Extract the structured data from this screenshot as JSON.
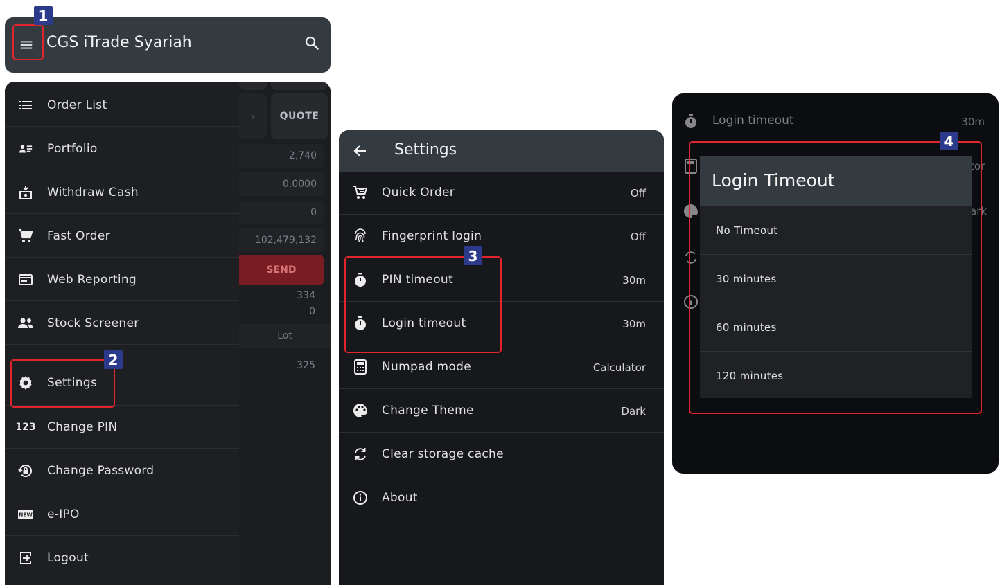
{
  "app_bar": {
    "title": "CGS iTrade Syariah",
    "menu_icon": "hamburger-menu-icon",
    "search_icon": "search-icon"
  },
  "order_background": {
    "quote_label": "QUOTE",
    "fields": [
      "2,740",
      "0.0000",
      "0",
      "102,479,132"
    ],
    "send_label": "SEND",
    "numbers": [
      "334",
      "0"
    ],
    "lot_label": "Lot",
    "row_value": "325"
  },
  "drawer": {
    "items": [
      {
        "label": "Order List",
        "icon": "list-icon"
      },
      {
        "label": "Portfolio",
        "icon": "portfolio-icon"
      },
      {
        "label": "Withdraw Cash",
        "icon": "withdraw-cash-icon"
      },
      {
        "label": "Fast Order",
        "icon": "cart-icon"
      },
      {
        "label": "Web Reporting",
        "icon": "web-reporting-icon"
      },
      {
        "label": "Stock Screener",
        "icon": "people-icon"
      },
      {
        "label": "Settings",
        "icon": "gear-icon"
      },
      {
        "label": "Change PIN",
        "icon": "pin-123-icon"
      },
      {
        "label": "Change Password",
        "icon": "password-lock-icon"
      },
      {
        "label": "e-IPO",
        "icon": "new-badge-icon"
      },
      {
        "label": "Logout",
        "icon": "logout-icon"
      }
    ]
  },
  "settings": {
    "title": "Settings",
    "rows": [
      {
        "label": "Quick Order",
        "value": "Off",
        "icon": "quick-order-cart-icon"
      },
      {
        "label": "Fingerprint login",
        "value": "Off",
        "icon": "fingerprint-icon"
      },
      {
        "label": "PIN timeout",
        "value": "30m",
        "icon": "timer-icon"
      },
      {
        "label": "Login timeout",
        "value": "30m",
        "icon": "timer-icon"
      },
      {
        "label": "Numpad mode",
        "value": "Calculator",
        "icon": "calculator-icon"
      },
      {
        "label": "Change Theme",
        "value": "Dark",
        "icon": "palette-icon"
      },
      {
        "label": "Clear storage cache",
        "value": "",
        "icon": "refresh-icon"
      },
      {
        "label": "About",
        "value": "",
        "icon": "info-icon"
      }
    ]
  },
  "dialog_background": {
    "login_timeout_label": "Login timeout",
    "login_timeout_value": "30m",
    "numpad_value_fragment": "tor",
    "theme_value_fragment": "ark"
  },
  "dialog": {
    "title": "Login Timeout",
    "options": [
      "No Timeout",
      "30 minutes",
      "60 minutes",
      "120 minutes"
    ]
  },
  "callouts": [
    "1",
    "2",
    "3",
    "4"
  ],
  "colors": {
    "highlight": "#e0262c",
    "badge": "#2c3a8c",
    "app_bar": "#333a40",
    "send": "#7a1d22"
  }
}
